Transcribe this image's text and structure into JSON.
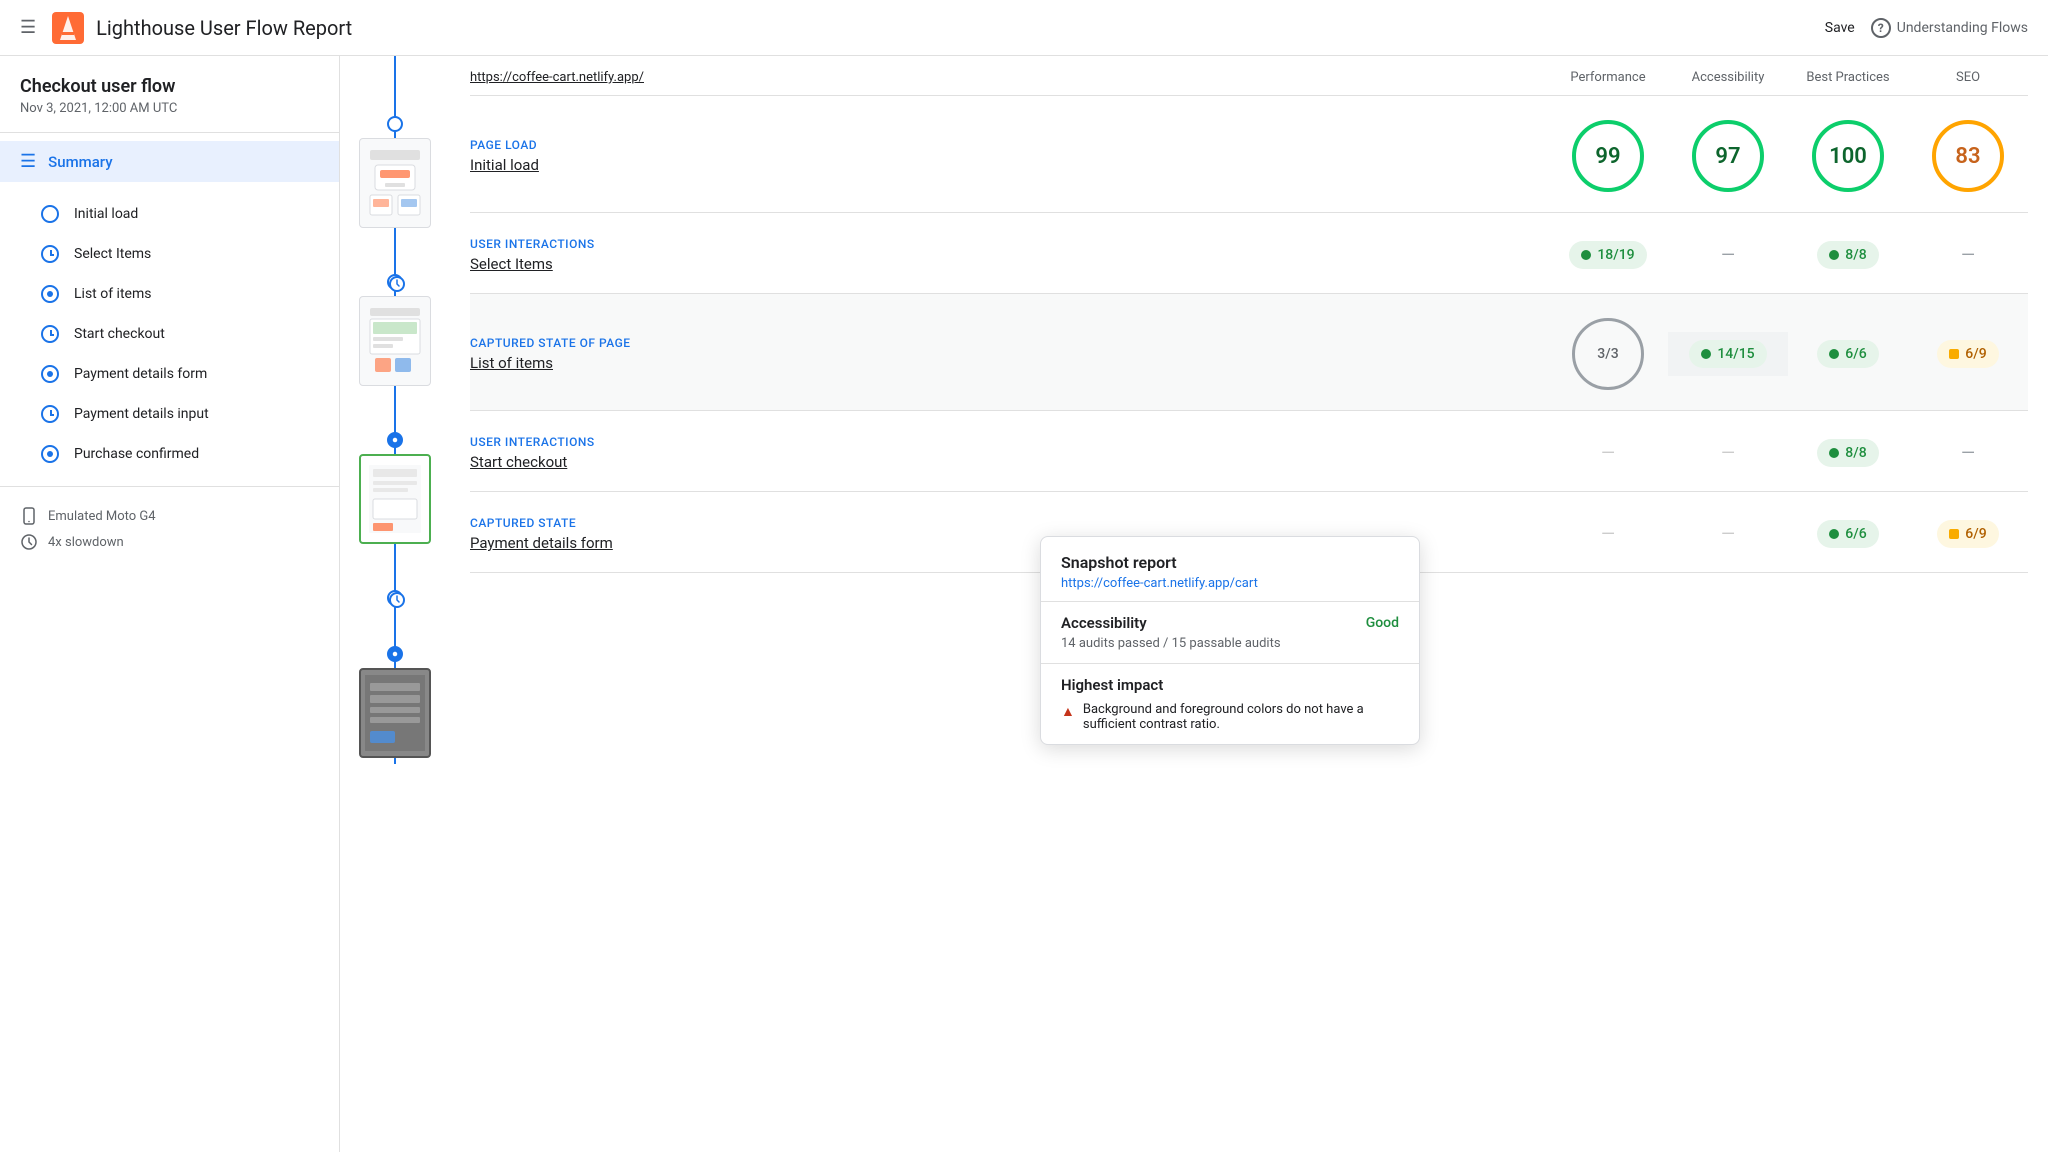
{
  "header": {
    "menu_label": "☰",
    "title": "Lighthouse User Flow Report",
    "save_label": "Save",
    "help_label": "Understanding Flows"
  },
  "sidebar": {
    "flow_title": "Checkout user flow",
    "flow_date": "Nov 3, 2021, 12:00 AM UTC",
    "summary_label": "Summary",
    "items": [
      {
        "id": "initial-load",
        "label": "Initial load",
        "type": "circle"
      },
      {
        "id": "select-items",
        "label": "Select Items",
        "type": "clock"
      },
      {
        "id": "list-of-items",
        "label": "List of items",
        "type": "snapshot"
      },
      {
        "id": "start-checkout",
        "label": "Start checkout",
        "type": "clock"
      },
      {
        "id": "payment-details-form",
        "label": "Payment details form",
        "type": "snapshot"
      },
      {
        "id": "payment-details-input",
        "label": "Payment details input",
        "type": "clock"
      },
      {
        "id": "purchase-confirmed",
        "label": "Purchase confirmed",
        "type": "snapshot"
      }
    ],
    "footer_items": [
      {
        "id": "emulated-device",
        "label": "Emulated Moto G4"
      },
      {
        "id": "slowdown",
        "label": "4x slowdown"
      }
    ]
  },
  "scores_header": {
    "url_label": "https://coffee-cart.netlify.app/",
    "col1": "Performance",
    "col2": "Accessibility",
    "col3": "Best Practices",
    "col4": "SEO"
  },
  "sections": [
    {
      "id": "page-load",
      "type_label": "Page load",
      "name_label": "Initial load",
      "scores": [
        {
          "type": "circle",
          "value": "99",
          "color": "green"
        },
        {
          "type": "circle",
          "value": "97",
          "color": "green"
        },
        {
          "type": "circle",
          "value": "100",
          "color": "green"
        },
        {
          "type": "circle",
          "value": "83",
          "color": "orange"
        }
      ]
    },
    {
      "id": "user-interactions-1",
      "type_label": "User interactions",
      "name_label": "Select Items",
      "scores": [
        {
          "type": "badge",
          "value": "18/19",
          "color": "green"
        },
        {
          "type": "dash",
          "value": "—"
        },
        {
          "type": "badge",
          "value": "8/8",
          "color": "green"
        },
        {
          "type": "dash",
          "value": "—"
        }
      ]
    },
    {
      "id": "captured-state-1",
      "type_label": "Captured state of page",
      "name_label": "List of items",
      "scores": [
        {
          "type": "outline",
          "value": "3/3"
        },
        {
          "type": "badge",
          "value": "14/15",
          "color": "green",
          "highlight": true
        },
        {
          "type": "badge",
          "value": "6/6",
          "color": "green"
        },
        {
          "type": "badge",
          "value": "6/9",
          "color": "orange"
        }
      ]
    },
    {
      "id": "user-interactions-2",
      "type_label": "User interactions",
      "name_label": "Start checkout",
      "scores": [
        {
          "type": "hidden",
          "value": ""
        },
        {
          "type": "hidden",
          "value": ""
        },
        {
          "type": "badge",
          "value": "8/8",
          "color": "green"
        },
        {
          "type": "dash",
          "value": "—"
        }
      ]
    },
    {
      "id": "captured-state-2",
      "type_label": "Captured state",
      "name_label": "Payment details form",
      "scores": [
        {
          "type": "hidden",
          "value": ""
        },
        {
          "type": "hidden",
          "value": ""
        },
        {
          "type": "badge",
          "value": "6/6",
          "color": "green"
        },
        {
          "type": "badge",
          "value": "6/9",
          "color": "orange"
        }
      ]
    }
  ],
  "tooltip": {
    "title": "Snapshot report",
    "url": "https://coffee-cart.netlify.app/cart",
    "accessibility_label": "Accessibility",
    "accessibility_status": "Good",
    "accessibility_desc": "14 audits passed / 15 passable audits",
    "impact_label": "Highest impact",
    "impact_item": "Background and foreground colors do not have a sufficient contrast ratio."
  },
  "colors": {
    "blue": "#1a73e8",
    "green": "#1e8e3e",
    "orange": "#f9ab00",
    "red": "#c5341a"
  }
}
